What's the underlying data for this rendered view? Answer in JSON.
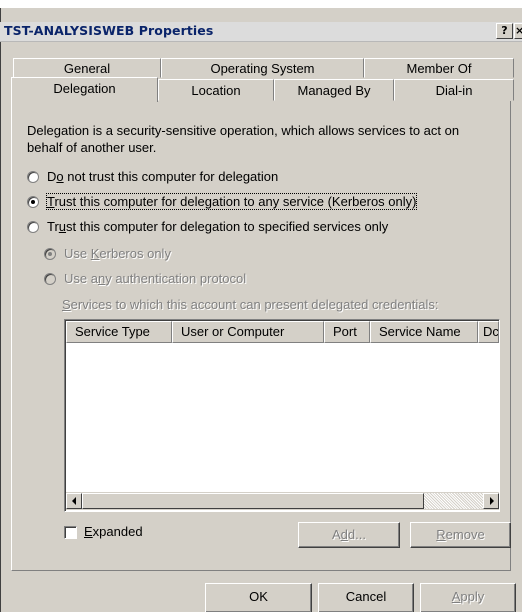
{
  "window": {
    "title": "TST-ANALYSISWEB Properties",
    "help_glyph": "?",
    "close_glyph": "×"
  },
  "tabs": {
    "row_back": [
      "General",
      "Operating System",
      "Member Of"
    ],
    "row_front": [
      "Delegation",
      "Location",
      "Managed By",
      "Dial-in"
    ],
    "active": "Delegation"
  },
  "delegation": {
    "description_line1": "Delegation is a security-sensitive operation, which allows services to act on",
    "description_line2": "behalf of another user.",
    "options": [
      {
        "pre": "D",
        "mnemonic": "o",
        "post": " not trust this computer for delegation",
        "selected": false
      },
      {
        "pre": "",
        "mnemonic": "T",
        "post": "rust this computer for delegation to any service (Kerberos only)",
        "selected": true
      },
      {
        "pre": "Tr",
        "mnemonic": "u",
        "post": "st this computer for delegation to specified services only",
        "selected": false
      }
    ],
    "sub_options": [
      {
        "pre": "Use ",
        "mnemonic": "K",
        "post": "erberos only",
        "selected": true
      },
      {
        "pre": "Use a",
        "mnemonic": "n",
        "post": "y authentication protocol",
        "selected": false
      }
    ],
    "services_label_mnemonic": "S",
    "services_label_rest": "ervices to which this account can present delegated credentials:",
    "columns": [
      "Service Type",
      "User or Computer",
      "Port",
      "Service Name",
      "Dc"
    ],
    "rows": [],
    "expanded_mnemonic": "E",
    "expanded_rest": "xpanded",
    "expanded_checked": false,
    "add_label_pre": "A",
    "add_label_mnemonic": "d",
    "add_label_post": "d...",
    "remove_label_mnemonic": "R",
    "remove_label_rest": "emove"
  },
  "footer": {
    "ok": "OK",
    "cancel": "Cancel",
    "apply_mnemonic": "A",
    "apply_rest": "pply"
  }
}
